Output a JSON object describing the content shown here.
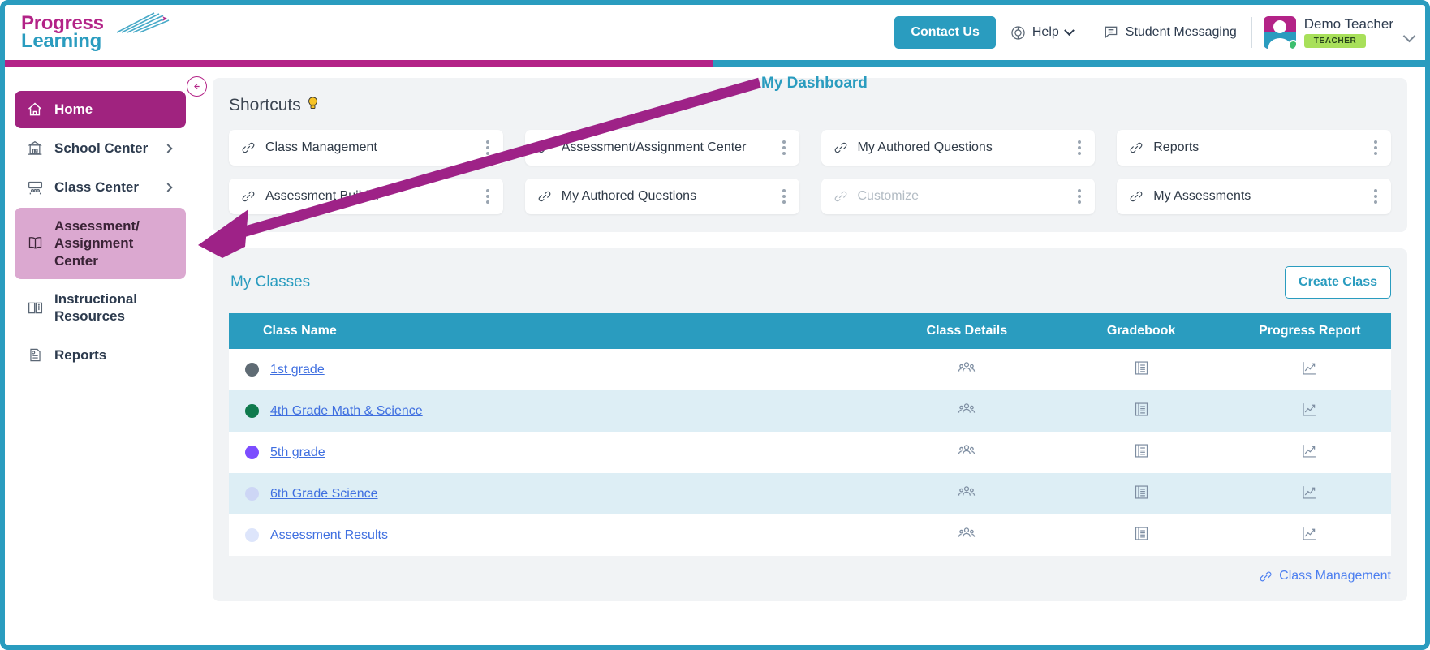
{
  "header": {
    "logo_line1": "Progress",
    "logo_line2": "Learning",
    "contact_label": "Contact Us",
    "help_label": "Help",
    "help_icon": "lifebuoy-icon",
    "messaging_label": "Student Messaging",
    "messaging_icon": "chat-bubble-icon",
    "user_name": "Demo Teacher",
    "user_role_badge": "TEACHER",
    "avatar_icon": "user-avatar",
    "status_dot_color": "#3dbf6e",
    "brand_pink": "#b32387",
    "brand_teal": "#2a9cbf"
  },
  "sidebar": {
    "collapse_icon": "collapse-left-icon",
    "items": [
      {
        "label": "Home",
        "icon": "home-icon",
        "state": "active",
        "has_arrow": false
      },
      {
        "label": "School Center",
        "icon": "school-icon",
        "state": "normal",
        "has_arrow": true
      },
      {
        "label": "Class Center",
        "icon": "classroom-icon",
        "state": "normal",
        "has_arrow": true
      },
      {
        "label": "Assessment/ Assignment Center",
        "icon": "book-open-icon",
        "state": "selected",
        "has_arrow": false
      },
      {
        "label": "Instructional Resources",
        "icon": "book-info-icon",
        "state": "normal",
        "has_arrow": false
      },
      {
        "label": "Reports",
        "icon": "report-icon",
        "state": "normal",
        "has_arrow": false
      }
    ]
  },
  "annotation": {
    "label": "My Dashboard",
    "arrow_color": "#9e2287",
    "text_color": "#2a9cbf"
  },
  "shortcuts": {
    "title": "Shortcuts",
    "bulb_icon": "lightbulb-icon",
    "kebab_icon": "kebab-menu-icon",
    "link_icon": "link-icon",
    "cards": [
      {
        "label": "Class Management",
        "disabled": false
      },
      {
        "label": "Assessment/Assignment Center",
        "disabled": false
      },
      {
        "label": "My Authored Questions",
        "disabled": false
      },
      {
        "label": "Reports",
        "disabled": false
      },
      {
        "label": "Assessment Builder",
        "disabled": false
      },
      {
        "label": "My Authored Questions",
        "disabled": false
      },
      {
        "label": "Customize",
        "disabled": true
      },
      {
        "label": "My Assessments",
        "disabled": false
      }
    ]
  },
  "classes": {
    "title": "My Classes",
    "create_button": "Create Class",
    "columns": [
      "Class Name",
      "Class Details",
      "Gradebook",
      "Progress Report"
    ],
    "details_icon": "people-group-icon",
    "gradebook_icon": "gradebook-book-icon",
    "progress_icon": "trending-up-chart-icon",
    "rows": [
      {
        "name": "1st grade",
        "color": "#5f6b74"
      },
      {
        "name": "4th Grade Math & Science",
        "color": "#0f7a4d"
      },
      {
        "name": "5th grade",
        "color": "#7c4dff"
      },
      {
        "name": "6th Grade Science",
        "color": "#cdd6f5"
      },
      {
        "name": "Assessment Results",
        "color": "#dde5fb"
      }
    ],
    "footer_link": "Class Management",
    "footer_link_icon": "link-icon"
  }
}
